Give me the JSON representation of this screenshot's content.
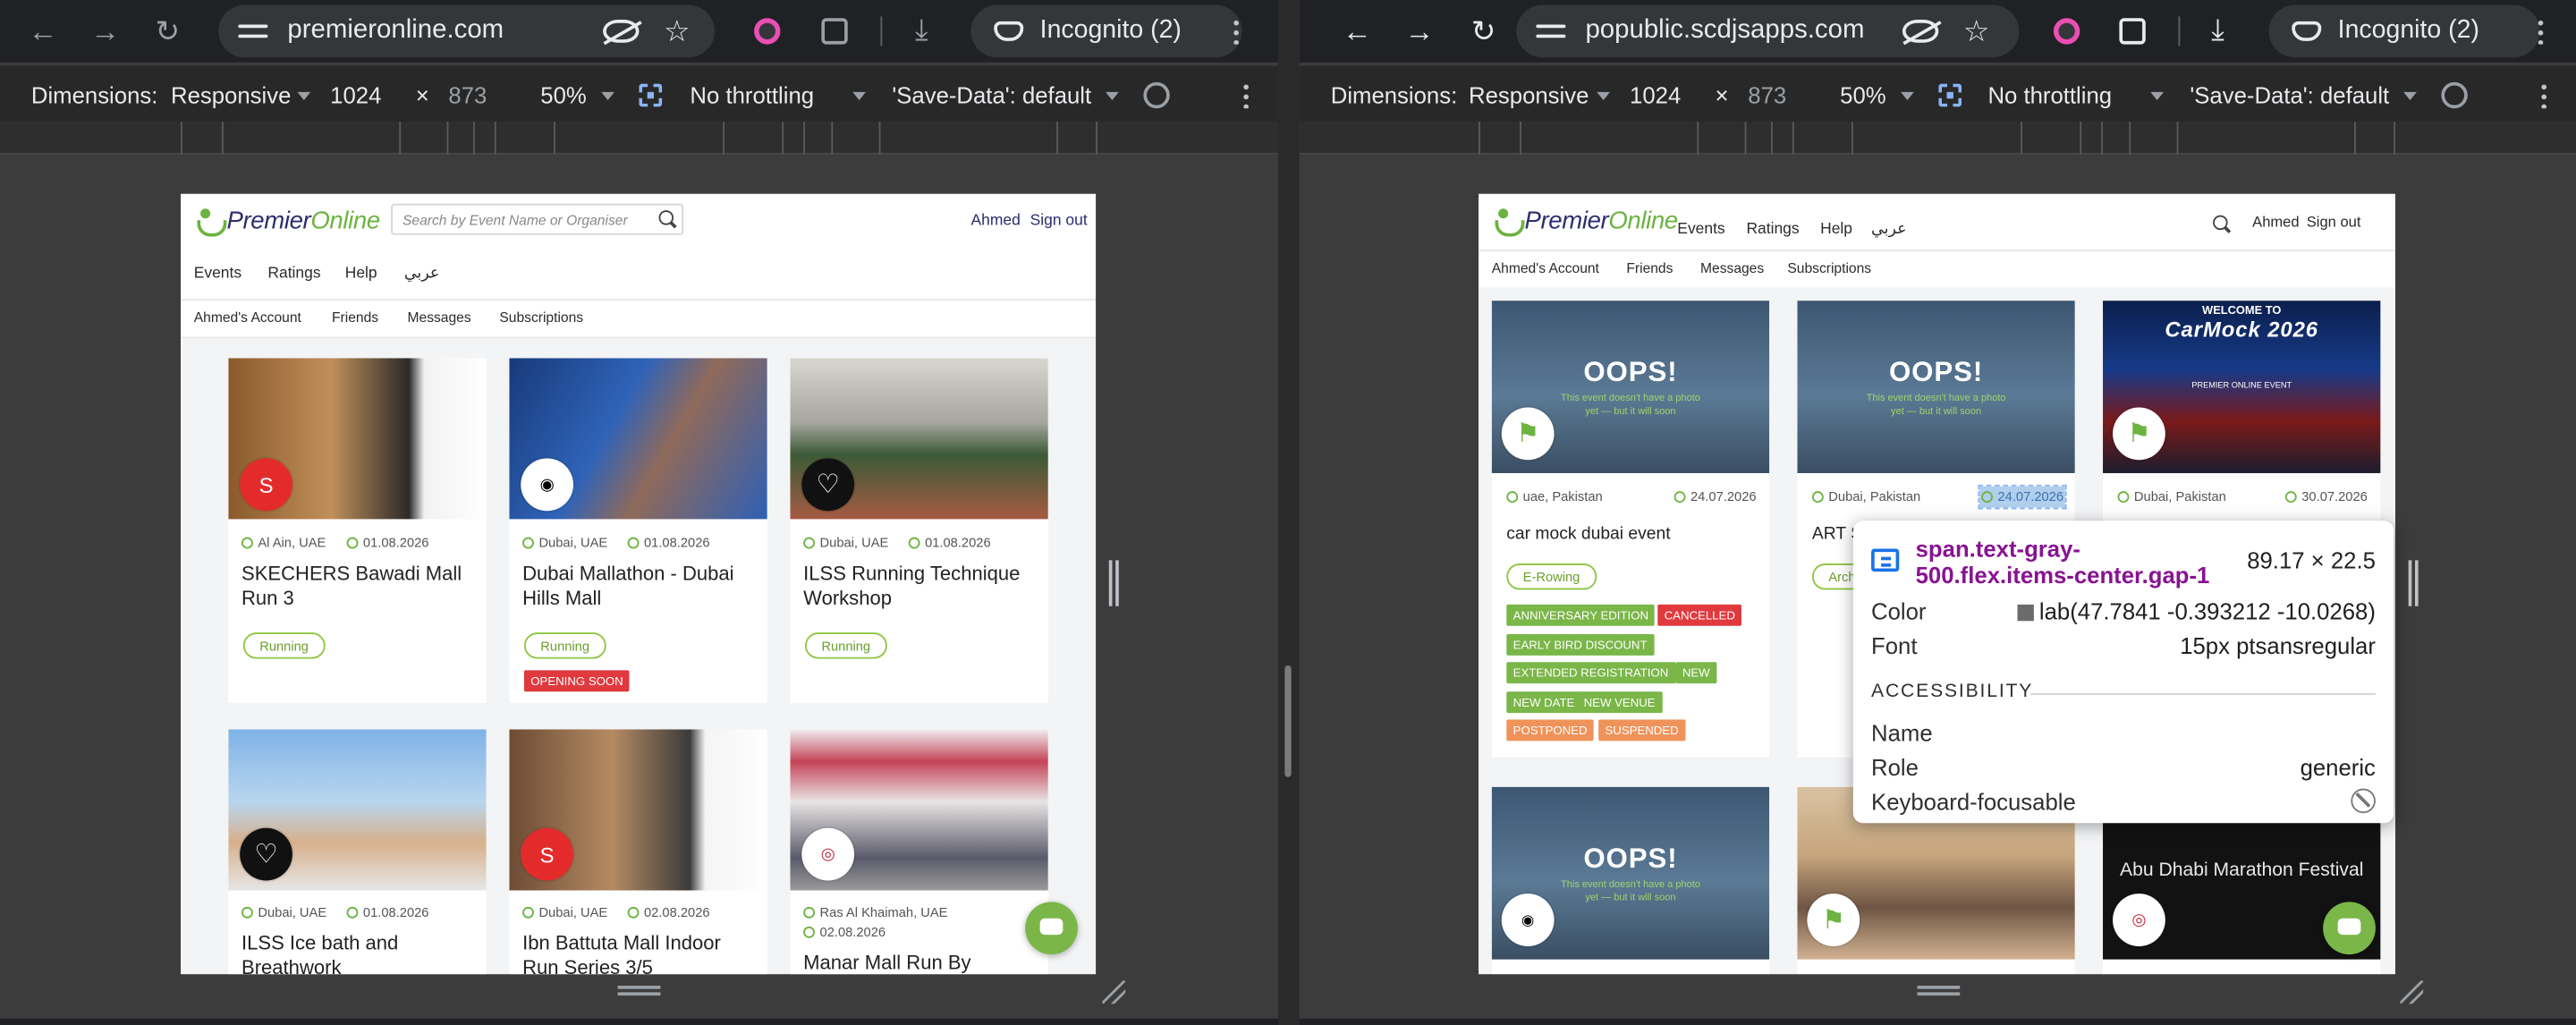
{
  "left_browser": {
    "url": "premieronline.com",
    "incognito": "Incognito (2)",
    "devtools": {
      "dimensions_label": "Dimensions:",
      "mode": "Responsive",
      "width": "1024",
      "times": "×",
      "height": "873",
      "zoom": "50%",
      "throttle": "No throttling",
      "save_data": "'Save-Data': default"
    },
    "site": {
      "search_placeholder": "Search by Event Name or Organiser",
      "user": "Ahmed",
      "sign_out": "Sign out",
      "nav": [
        "Events",
        "Ratings",
        "Help",
        "عربي"
      ],
      "subnav": [
        "Ahmed's Account",
        "Friends",
        "Messages",
        "Subscriptions"
      ],
      "cards": [
        {
          "location": "Al Ain, UAE",
          "date": "01.08.2026",
          "title": "SKECHERS Bawadi Mall Run 3",
          "pill": "Running",
          "tags": []
        },
        {
          "location": "Dubai, UAE",
          "date": "01.08.2026",
          "title": "Dubai Mallathon - Dubai Hills Mall",
          "pill": "Running",
          "tags": [
            "OPENING SOON"
          ]
        },
        {
          "location": "Dubai, UAE",
          "date": "01.08.2026",
          "title": "ILSS Running Technique Workshop",
          "pill": "Running",
          "tags": []
        },
        {
          "location": "Dubai, UAE",
          "date": "01.08.2026",
          "title": "ILSS Ice bath and Breathwork",
          "pill": "",
          "tags": []
        },
        {
          "location": "Dubai, UAE",
          "date": "02.08.2026",
          "title": "Ibn Battuta Mall Indoor Run Series 3/5",
          "pill": "",
          "tags": []
        },
        {
          "location": "Ras Al Khaimah, UAE",
          "date": "02.08.2026",
          "title": "Manar Mall Run By",
          "pill": "",
          "tags": []
        }
      ]
    }
  },
  "right_browser": {
    "url": "popublic.scdjsapps.com",
    "incognito": "Incognito (2)",
    "devtools": {
      "dimensions_label": "Dimensions:",
      "mode": "Responsive",
      "width": "1024",
      "times": "×",
      "height": "873",
      "zoom": "50%",
      "throttle": "No throttling",
      "save_data": "'Save-Data': default"
    },
    "site": {
      "nav": [
        "Events",
        "Ratings",
        "Help",
        "عربي"
      ],
      "user": "Ahmed",
      "sign_out": "Sign out",
      "subnav": [
        "Ahmed's Account",
        "Friends",
        "Messages",
        "Subscriptions"
      ],
      "oops": "OOPS!",
      "oops_sub": "This event doesn't have a photo yet — but it will soon",
      "cards": [
        {
          "location": "uae, Pakistan",
          "date": "24.07.2026",
          "title": "car mock dubai event",
          "pill": "E-Rowing",
          "tags": [
            {
              "text": "ANNIVERSARY EDITION",
              "color": "#7ab648"
            },
            {
              "text": "CANCELLED",
              "color": "#e0393e"
            },
            {
              "text": "EARLY BIRD DISCOUNT",
              "color": "#7ab648"
            },
            {
              "text": "EXTENDED REGISTRATION",
              "color": "#7ab648"
            },
            {
              "text": "NEW",
              "color": "#7ab648"
            },
            {
              "text": "NEW DATE",
              "color": "#7ab648"
            },
            {
              "text": "NEW VENUE",
              "color": "#7ab648"
            },
            {
              "text": "POSTPONED",
              "color": "#f0935a"
            },
            {
              "text": "SUSPENDED",
              "color": "#f0935a"
            }
          ]
        },
        {
          "location": "Dubai, Pakistan",
          "date": "24.07.2026",
          "title": "ART S",
          "pill": "Arche",
          "tags": []
        },
        {
          "location": "Dubai, Pakistan",
          "date": "30.07.2026",
          "title": "",
          "pill": "",
          "tags": [],
          "banner_top": "WELCOME TO",
          "banner": "CarMock 2026",
          "banner_sub": "PREMIER ONLINE EVENT"
        },
        {
          "title": ""
        },
        {
          "title": ""
        },
        {
          "title": "Abu Dhabi Marathon Festival"
        }
      ]
    },
    "inspector": {
      "selector": "span.text-gray-500.flex.items-center.gap-1",
      "size": "89.17 × 22.5",
      "color_label": "Color",
      "color_value": "lab(47.7841 -0.393212 -10.0268)",
      "font_label": "Font",
      "font_value": "15px ptsansregular",
      "section": "ACCESSIBILITY",
      "name_label": "Name",
      "name_value": "",
      "role_label": "Role",
      "role_value": "generic",
      "focus_label": "Keyboard-focusable"
    }
  },
  "colors": {
    "accent_green": "#7ab648",
    "brand_navy": "#2d2d6e",
    "danger": "#e0393e",
    "warning": "#f0935a",
    "inspector_selector": "#881391"
  }
}
